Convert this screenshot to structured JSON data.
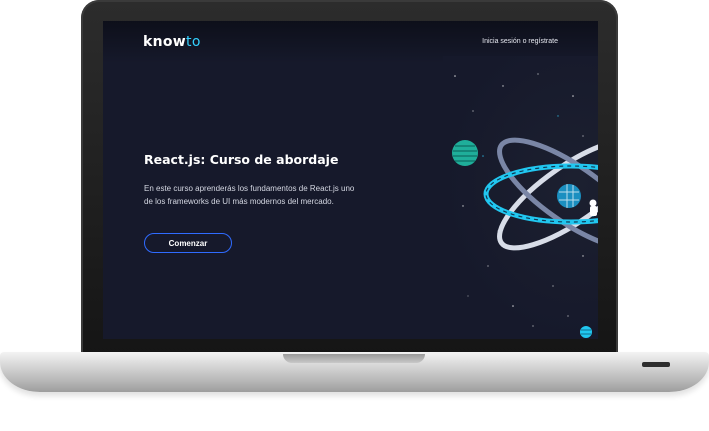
{
  "header": {
    "logo_main": "know",
    "logo_accent": "to",
    "login_text": "Inicia sesión o regístrate"
  },
  "hero": {
    "title": "React.js: Curso de abordaje",
    "description": "En este curso aprenderás los fundamentos de React.js uno de los frameworks de UI más modernos del mercado.",
    "cta_label": "Comenzar"
  },
  "illustration": {
    "icon_name": "react-atom-space-icon",
    "elements": [
      "atom-orbits",
      "planet",
      "astronaut",
      "stars"
    ]
  },
  "colors": {
    "background": "#16192b",
    "accent": "#33d1ff",
    "button_border": "#2f6bff",
    "text": "#ffffff"
  }
}
